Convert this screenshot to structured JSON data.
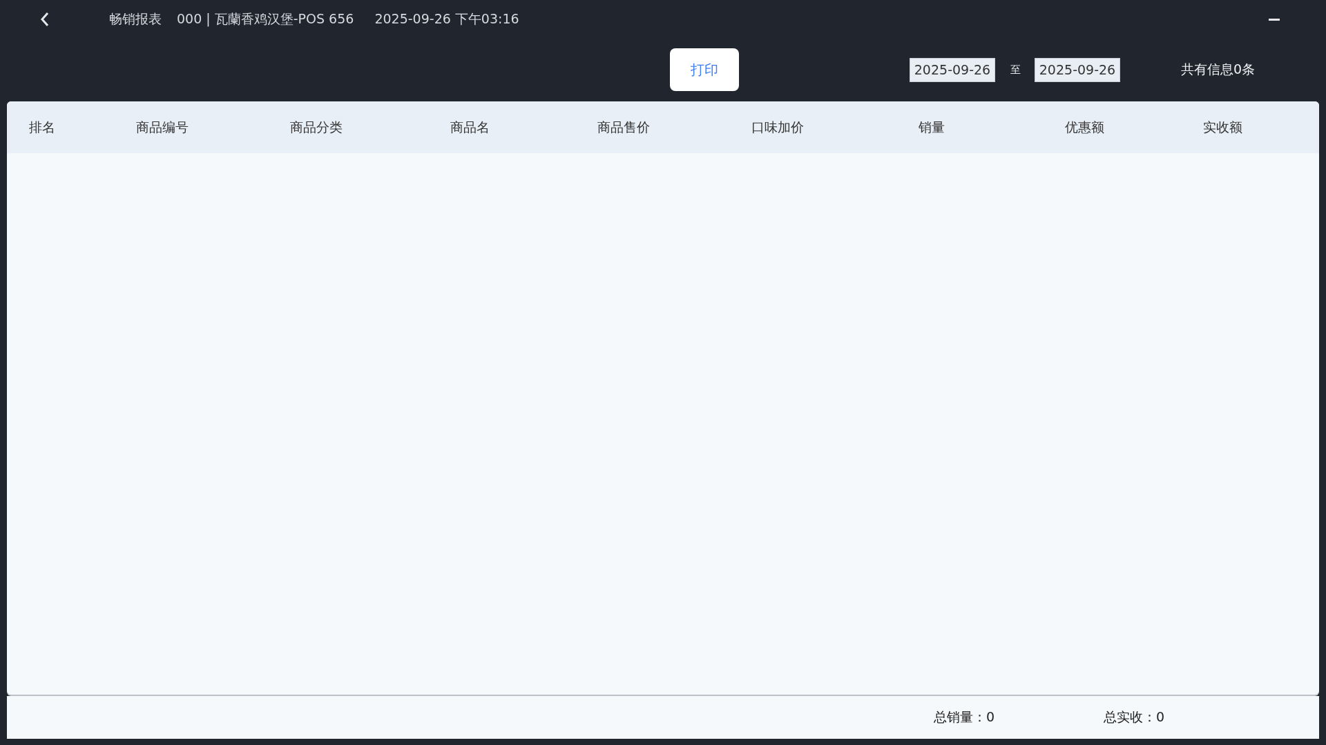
{
  "header": {
    "title": "畅销报表",
    "store": "000 | 瓦蘭香鸡汉堡-POS 656",
    "datetime": "2025-09-26 下午03:16"
  },
  "toolbar": {
    "print_button": "打印",
    "date_from": "2025-09-26",
    "date_separator": "至",
    "date_to": "2025-09-26",
    "record_count": "共有信息0条"
  },
  "table": {
    "columns": [
      "排名",
      "商品编号",
      "商品分类",
      "商品名",
      "商品售价",
      "口味加价",
      "销量",
      "优惠额",
      "实收额"
    ]
  },
  "footer": {
    "total_sales": "总销量：0",
    "total_received": "总实收：0"
  }
}
